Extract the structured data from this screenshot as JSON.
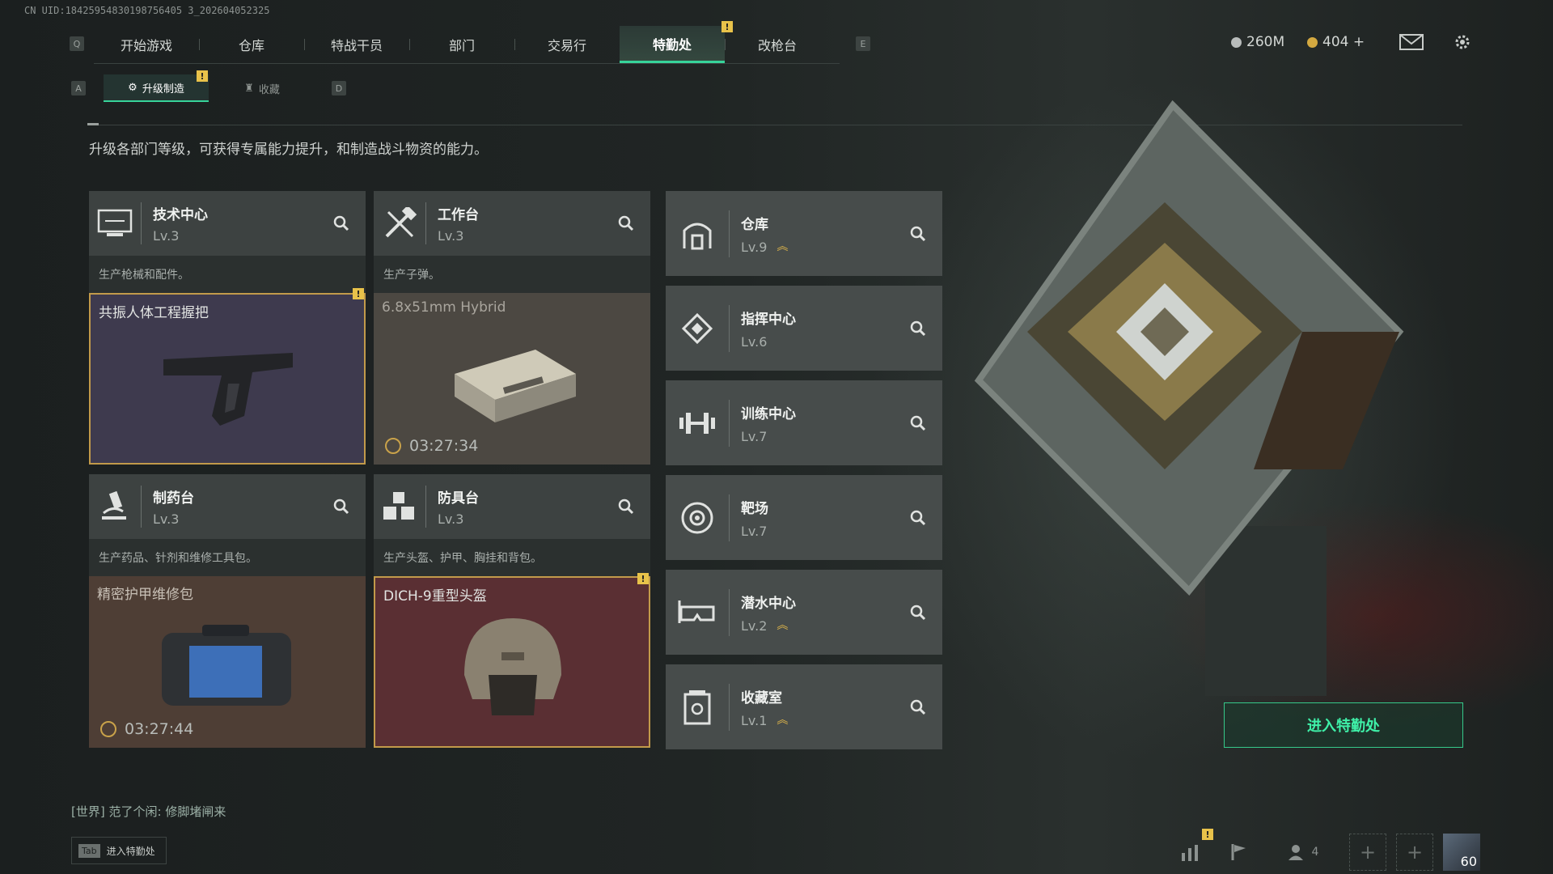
{
  "uid": "CN UID:18425954830198756405 3_202604052325",
  "nav": {
    "left_key": "Q",
    "right_key": "E",
    "tabs": [
      "开始游戏",
      "仓库",
      "特战干员",
      "部门",
      "交易行",
      "特勤处",
      "改枪台"
    ],
    "active": "特勤处",
    "alert": "!"
  },
  "currency": {
    "silver": "260M",
    "gold": "404 +"
  },
  "subnav": {
    "left_key": "A",
    "right_key": "D",
    "tabs": [
      "升级制造",
      "收藏"
    ],
    "active": "升级制造",
    "alert": "!"
  },
  "description": "升级各部门等级，可获得专属能力提升，和制造战斗物资的能力。",
  "workshops": [
    {
      "name": "技术中心",
      "level": "Lv.3",
      "desc": "生产枪械和配件。",
      "item": "共振人体工程握把",
      "timer": "",
      "alert": "!",
      "bg": "#3e3a4e"
    },
    {
      "name": "工作台",
      "level": "Lv.3",
      "desc": "生产子弹。",
      "item": "6.8x51mm Hybrid",
      "timer": "03:27:34",
      "alert": "",
      "bg": "#4c4842"
    },
    {
      "name": "制药台",
      "level": "Lv.3",
      "desc": "生产药品、针剂和维修工具包。",
      "item": "精密护甲维修包",
      "timer": "03:27:44",
      "alert": "",
      "bg": "#4e3e35"
    },
    {
      "name": "防具台",
      "level": "Lv.3",
      "desc": "生产头盔、护甲、胸挂和背包。",
      "item": "DICH-9重型头盔",
      "timer": "",
      "alert": "!",
      "bg": "#5a2f33"
    }
  ],
  "departments": [
    {
      "name": "仓库",
      "level": "Lv.9",
      "upgrade": true
    },
    {
      "name": "指挥中心",
      "level": "Lv.6",
      "upgrade": false
    },
    {
      "name": "训练中心",
      "level": "Lv.7",
      "upgrade": false
    },
    {
      "name": "靶场",
      "level": "Lv.7",
      "upgrade": false
    },
    {
      "name": "潜水中心",
      "level": "Lv.2",
      "upgrade": true
    },
    {
      "name": "收藏室",
      "level": "Lv.1",
      "upgrade": true
    }
  ],
  "enter_button": "进入特勤处",
  "chat": {
    "channel": "[世界]",
    "user": "范了个闲:",
    "message": "修脚堵闸来"
  },
  "tab_hint": {
    "key": "Tab",
    "label": "进入特勤处"
  },
  "bottom": {
    "friends": "4",
    "level": "60",
    "alert": "!"
  },
  "colors": {
    "accent": "#37d49a",
    "warning": "#e8c24a"
  }
}
